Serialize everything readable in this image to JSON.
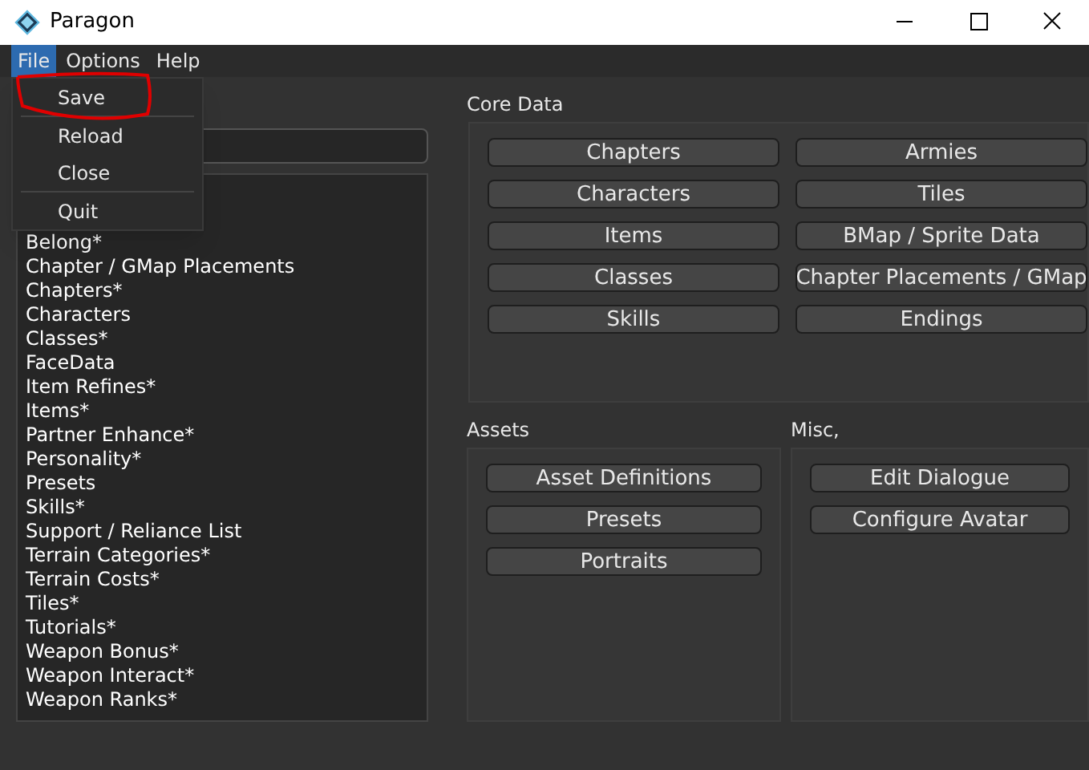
{
  "window": {
    "title": "Paragon"
  },
  "menu_bar": [
    {
      "label": "File",
      "selected": true
    },
    {
      "label": "Options",
      "selected": false
    },
    {
      "label": "Help",
      "selected": false
    }
  ],
  "file_menu": [
    "Save",
    "Reload",
    "Close",
    "Quit"
  ],
  "file_list": [
    "Belong*",
    "Chapter / GMap Placements",
    "Chapters*",
    "Characters",
    "Classes*",
    "FaceData",
    "Item Refines*",
    "Items*",
    "Partner Enhance*",
    "Personality*",
    "Presets",
    "Skills*",
    "Support / Reliance List",
    "Terrain Categories*",
    "Terrain Costs*",
    "Tiles*",
    "Tutorials*",
    "Weapon Bonus*",
    "Weapon Interact*",
    "Weapon Ranks*"
  ],
  "core_data": {
    "title": "Core Data",
    "buttons": [
      "Chapters",
      "Armies",
      "Characters",
      "Tiles",
      "Items",
      "BMap / Sprite Data",
      "Classes",
      "Chapter Placements / GMap",
      "Skills",
      "Endings"
    ]
  },
  "assets": {
    "title": "Assets",
    "buttons": [
      "Asset Definitions",
      "Presets",
      "Portraits"
    ]
  },
  "misc": {
    "title": "Misc,",
    "buttons": [
      "Edit Dialogue",
      "Configure Avatar"
    ]
  }
}
